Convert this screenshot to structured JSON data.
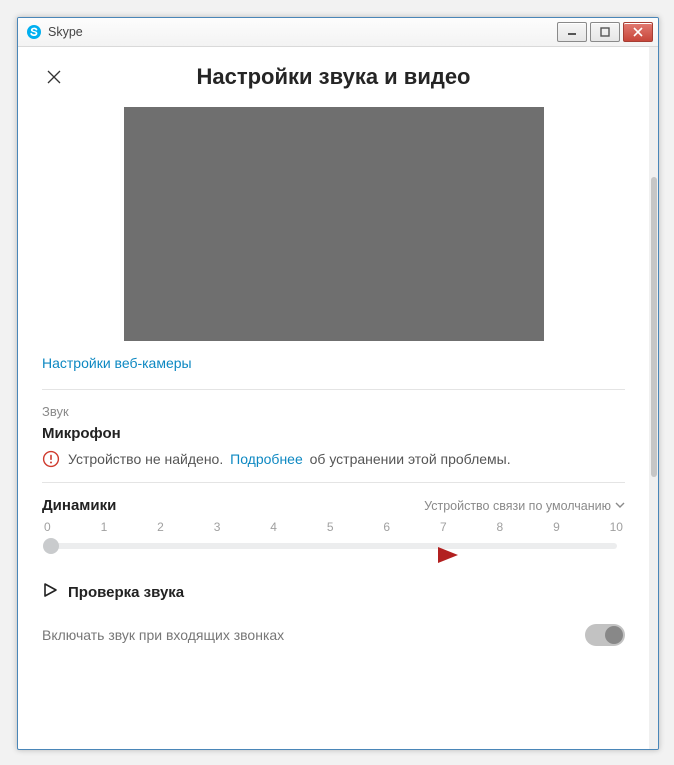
{
  "window": {
    "title": "Skype"
  },
  "header": {
    "title": "Настройки звука и видео"
  },
  "webcam": {
    "settings_link": "Настройки веб-камеры"
  },
  "audio": {
    "section_label": "Звук",
    "microphone_heading": "Микрофон",
    "not_found_prefix": "Устройство не найдено.",
    "learn_more": "Подробнее",
    "not_found_suffix": "об устранении этой проблемы.",
    "speakers_heading": "Динамики",
    "speakers_device": "Устройство связи по умолчанию",
    "slider": {
      "ticks": [
        "0",
        "1",
        "2",
        "3",
        "4",
        "5",
        "6",
        "7",
        "8",
        "9",
        "10"
      ],
      "value": 0
    },
    "test_audio": "Проверка звука",
    "ring_on_incoming": "Включать звук при входящих звонках",
    "ring_toggle_on": false
  }
}
